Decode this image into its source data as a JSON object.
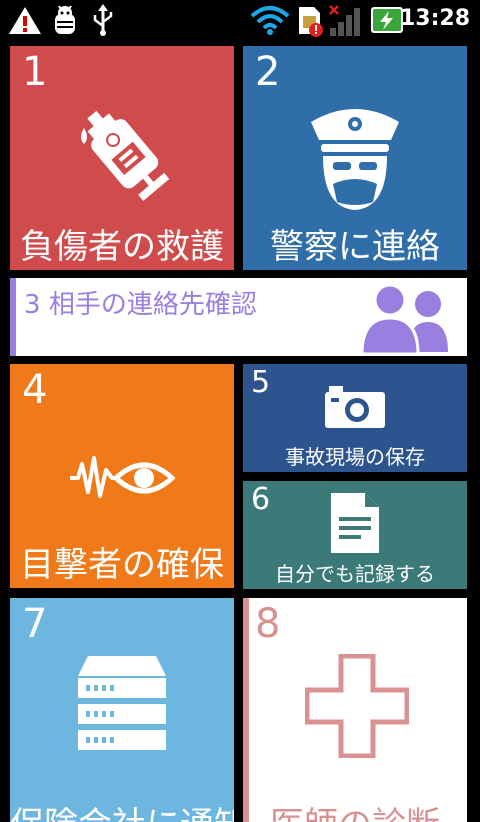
{
  "statusbar": {
    "time": "13:28",
    "icons": [
      "warning-icon",
      "android-debug-icon",
      "usb-icon",
      "wifi-icon",
      "sim-error-icon",
      "signal-icon",
      "battery-charging-icon"
    ]
  },
  "tiles": [
    {
      "num": "1",
      "label": "負傷者の救護",
      "color": "#d04b4b",
      "icon": "fire-extinguisher-icon"
    },
    {
      "num": "2",
      "label": "警察に連絡",
      "color": "#2f6ea8",
      "icon": "police-officer-icon"
    },
    {
      "num": "3",
      "label": "相手の連絡先確認",
      "color": "#ffffff",
      "accent": "#9a7ee0",
      "icon": "contacts-icon"
    },
    {
      "num": "4",
      "label": "目撃者の確保",
      "color": "#f07a1a",
      "icon": "eye-witness-icon"
    },
    {
      "num": "5",
      "label": "事故現場の保存",
      "color": "#2d548f",
      "icon": "camera-icon"
    },
    {
      "num": "6",
      "label": "自分でも記録する",
      "color": "#3b7a78",
      "icon": "document-icon"
    },
    {
      "num": "7",
      "label": "保険会社に通知",
      "color": "#6cb6e0",
      "icon": "server-icon"
    },
    {
      "num": "8",
      "label": "医師の診断",
      "color": "#ffffff",
      "accent": "#d89292",
      "icon": "medical-cross-icon"
    }
  ]
}
